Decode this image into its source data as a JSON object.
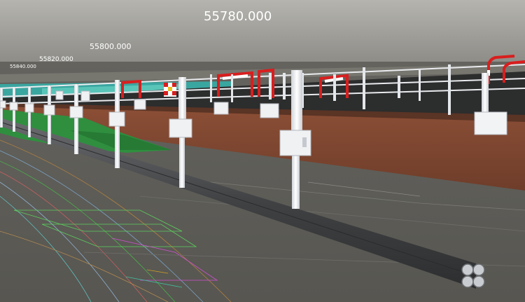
{
  "viewport": {
    "background_sky": "#a9a8a3",
    "background_ground": "#595954",
    "accent_cable": "#4f5153",
    "accent_post": "#e5e8ec",
    "accent_barrier": "#d91e1e",
    "accent_retaining_wall": "#7f4731",
    "accent_vegetation": "#2f8f3f"
  },
  "station_labels": [
    {
      "text": "55780.000"
    },
    {
      "text": "55800.000"
    },
    {
      "text": "55820.000"
    },
    {
      "text": "55840.000"
    }
  ]
}
